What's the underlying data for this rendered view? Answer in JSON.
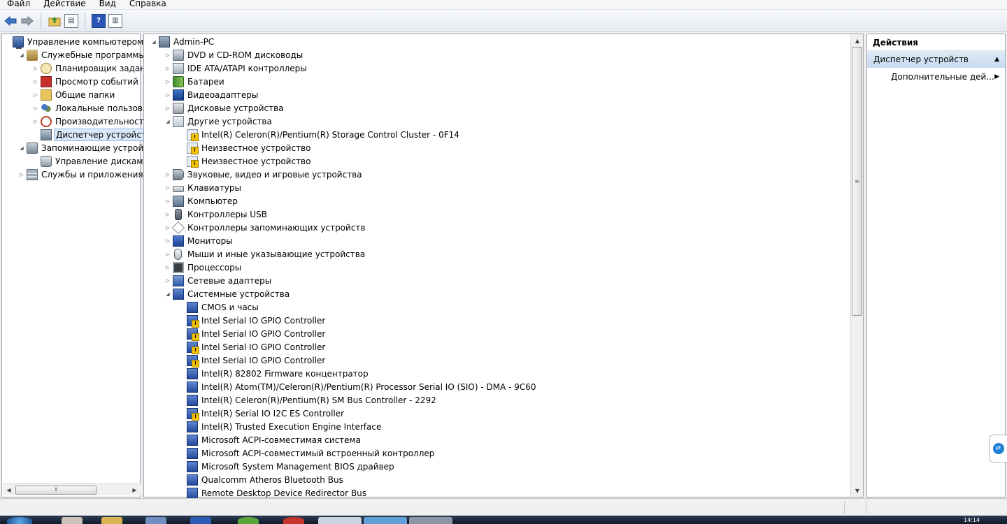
{
  "menu": [
    "Файл",
    "Действие",
    "Вид",
    "Справка"
  ],
  "toolbar": {
    "back": "back-arrow-icon",
    "forward": "forward-arrow-icon",
    "help_label": "?"
  },
  "left_tree": [
    {
      "label": "Управление компьютером (л",
      "icon": "computer-management",
      "level": 0,
      "toggle": "",
      "cls": "i-comp"
    },
    {
      "label": "Служебные программы",
      "icon": "tools",
      "level": 1,
      "toggle": "◢",
      "cls": "i-tools"
    },
    {
      "label": "Планировщик заданий",
      "icon": "clock",
      "level": 2,
      "toggle": "▷",
      "cls": "i-clock"
    },
    {
      "label": "Просмотр событий",
      "icon": "event-log",
      "level": 2,
      "toggle": "▷",
      "cls": "i-log"
    },
    {
      "label": "Общие папки",
      "icon": "shared-folder",
      "level": 2,
      "toggle": "▷",
      "cls": "i-folder"
    },
    {
      "label": "Локальные пользовате",
      "icon": "users",
      "level": 2,
      "toggle": "▷",
      "cls": "i-users"
    },
    {
      "label": "Производительность",
      "icon": "performance",
      "level": 2,
      "toggle": "▷",
      "cls": "i-perf"
    },
    {
      "label": "Диспетчер устройств",
      "icon": "device-manager",
      "level": 2,
      "toggle": "",
      "cls": "i-dev",
      "selected": true
    },
    {
      "label": "Запоминающие устройст",
      "icon": "storage",
      "level": 1,
      "toggle": "◢",
      "cls": "i-store"
    },
    {
      "label": "Управление дисками",
      "icon": "disk-management",
      "level": 2,
      "toggle": "",
      "cls": "i-disk"
    },
    {
      "label": "Службы и приложения",
      "icon": "services",
      "level": 1,
      "toggle": "▷",
      "cls": "i-svc"
    }
  ],
  "device_tree": [
    {
      "label": "Admin-PC",
      "level": 0,
      "toggle": "◢",
      "cls": "i-pc"
    },
    {
      "label": "DVD и CD-ROM дисководы",
      "level": 1,
      "toggle": "▷",
      "cls": "i-dvd"
    },
    {
      "label": "IDE ATA/ATAPI контроллеры",
      "level": 1,
      "toggle": "▷",
      "cls": "i-ide"
    },
    {
      "label": "Батареи",
      "level": 1,
      "toggle": "▷",
      "cls": "i-bat"
    },
    {
      "label": "Видеоадаптеры",
      "level": 1,
      "toggle": "▷",
      "cls": "i-vid"
    },
    {
      "label": "Дисковые устройства",
      "level": 1,
      "toggle": "▷",
      "cls": "i-hdd"
    },
    {
      "label": "Другие устройства",
      "level": 1,
      "toggle": "◢",
      "cls": "i-unk"
    },
    {
      "label": "Intel(R) Celeron(R)/Pentium(R) Storage Control Cluster  - 0F14",
      "level": 2,
      "toggle": "",
      "cls": "i-warn"
    },
    {
      "label": "Неизвестное устройство",
      "level": 2,
      "toggle": "",
      "cls": "i-warn"
    },
    {
      "label": "Неизвестное устройство",
      "level": 2,
      "toggle": "",
      "cls": "i-warn"
    },
    {
      "label": "Звуковые, видео и игровые устройства",
      "level": 1,
      "toggle": "▷",
      "cls": "i-snd"
    },
    {
      "label": "Клавиатуры",
      "level": 1,
      "toggle": "▷",
      "cls": "i-kbd"
    },
    {
      "label": "Компьютер",
      "level": 1,
      "toggle": "▷",
      "cls": "i-pc"
    },
    {
      "label": "Контроллеры USB",
      "level": 1,
      "toggle": "▷",
      "cls": "i-usb"
    },
    {
      "label": "Контроллеры запоминающих устройств",
      "level": 1,
      "toggle": "▷",
      "cls": "i-ctl"
    },
    {
      "label": "Мониторы",
      "level": 1,
      "toggle": "▷",
      "cls": "i-mon"
    },
    {
      "label": "Мыши и иные указывающие устройства",
      "level": 1,
      "toggle": "▷",
      "cls": "i-mouse"
    },
    {
      "label": "Процессоры",
      "level": 1,
      "toggle": "▷",
      "cls": "i-cpu"
    },
    {
      "label": "Сетевые адаптеры",
      "level": 1,
      "toggle": "▷",
      "cls": "i-net"
    },
    {
      "label": "Системные устройства",
      "level": 1,
      "toggle": "◢",
      "cls": "i-sys"
    },
    {
      "label": "CMOS и часы",
      "level": 2,
      "toggle": "",
      "cls": "i-sys"
    },
    {
      "label": "Intel Serial IO GPIO Controller",
      "level": 2,
      "toggle": "",
      "cls": "i-sysw"
    },
    {
      "label": "Intel Serial IO GPIO Controller",
      "level": 2,
      "toggle": "",
      "cls": "i-sysw"
    },
    {
      "label": "Intel Serial IO GPIO Controller",
      "level": 2,
      "toggle": "",
      "cls": "i-sysw"
    },
    {
      "label": "Intel Serial IO GPIO Controller",
      "level": 2,
      "toggle": "",
      "cls": "i-sysw"
    },
    {
      "label": "Intel(R) 82802 Firmware концентратор",
      "level": 2,
      "toggle": "",
      "cls": "i-sys"
    },
    {
      "label": "Intel(R) Atom(TM)/Celeron(R)/Pentium(R) Processor Serial IO (SIO) - DMA - 9C60",
      "level": 2,
      "toggle": "",
      "cls": "i-sys"
    },
    {
      "label": "Intel(R) Celeron(R)/Pentium(R) SM Bus Controller - 2292",
      "level": 2,
      "toggle": "",
      "cls": "i-sys"
    },
    {
      "label": "Intel(R) Serial IO I2C ES Controller",
      "level": 2,
      "toggle": "",
      "cls": "i-sysw"
    },
    {
      "label": "Intel(R) Trusted Execution Engine Interface",
      "level": 2,
      "toggle": "",
      "cls": "i-sys"
    },
    {
      "label": "Microsoft ACPI-совместимая система",
      "level": 2,
      "toggle": "",
      "cls": "i-sys"
    },
    {
      "label": "Microsoft ACPI-совместимый встроенный контроллер",
      "level": 2,
      "toggle": "",
      "cls": "i-sys"
    },
    {
      "label": "Microsoft System Management BIOS драйвер",
      "level": 2,
      "toggle": "",
      "cls": "i-sys"
    },
    {
      "label": "Qualcomm Atheros Bluetooth Bus",
      "level": 2,
      "toggle": "",
      "cls": "i-sys"
    },
    {
      "label": "Remote Desktop Device Redirector Bus",
      "level": 2,
      "toggle": "",
      "cls": "i-sys"
    }
  ],
  "actions": {
    "title": "Действия",
    "section": "Диспетчер устройств",
    "more": "Дополнительные дей..."
  },
  "taskbar": {
    "clock": "14:14"
  }
}
